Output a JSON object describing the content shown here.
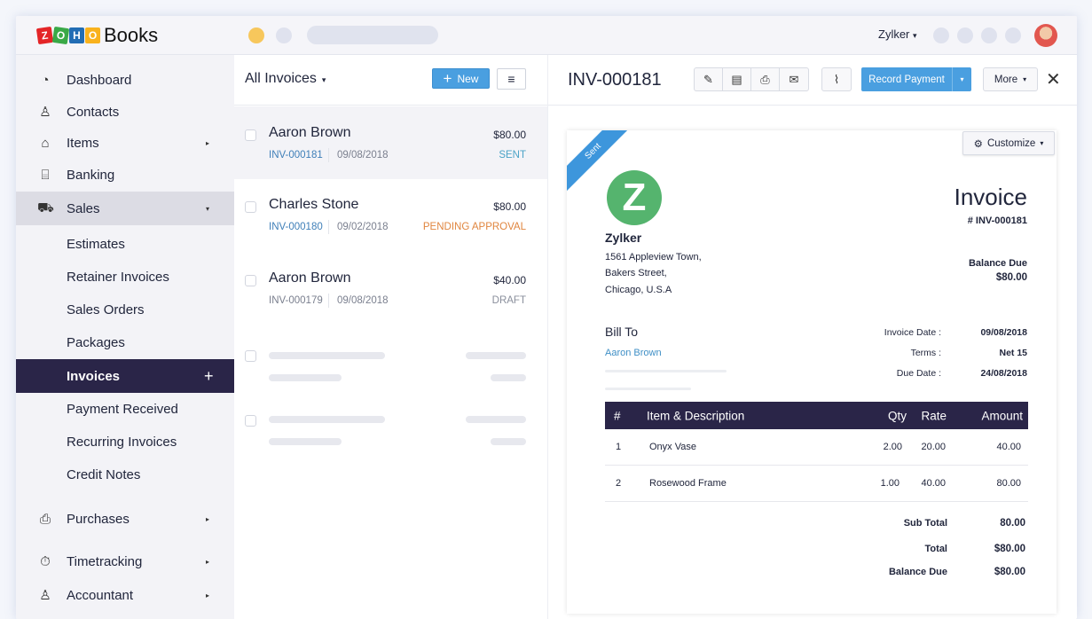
{
  "topbar": {
    "brand_letters": [
      "Z",
      "O",
      "H",
      "O"
    ],
    "brand_name": "Books",
    "org_name": "Zylker",
    "org_caret": "▾"
  },
  "sidebar": {
    "items": [
      {
        "label": "Dashboard",
        "icon": "dashboard-icon",
        "glyph": "◔"
      },
      {
        "label": "Contacts",
        "icon": "contacts-icon",
        "glyph": "♙"
      },
      {
        "label": "Items",
        "icon": "basket-icon",
        "glyph": "⌂",
        "arrow": "▸"
      },
      {
        "label": "Banking",
        "icon": "bank-icon",
        "glyph": "⌸"
      },
      {
        "label": "Sales",
        "icon": "cart-icon",
        "glyph": "⛟",
        "arrow": "▾"
      },
      {
        "label": "Purchases",
        "icon": "shopping-bag-icon",
        "glyph": "⎙",
        "arrow": "▸"
      },
      {
        "label": "Timetracking",
        "icon": "stopwatch-icon",
        "glyph": "⏱",
        "arrow": "▸"
      },
      {
        "label": "Accountant",
        "icon": "accountant-icon",
        "glyph": "♙",
        "arrow": "▸"
      }
    ],
    "sales_sub": [
      {
        "label": "Estimates"
      },
      {
        "label": "Retainer Invoices"
      },
      {
        "label": "Sales Orders"
      },
      {
        "label": "Packages"
      },
      {
        "label": "Invoices",
        "action": "+"
      },
      {
        "label": "Payment Received"
      },
      {
        "label": "Recurring Invoices"
      },
      {
        "label": "Credit Notes"
      }
    ]
  },
  "list": {
    "title": "All Invoices",
    "caret": "▾",
    "new_label": "New",
    "new_icon": "+",
    "menu_icon": "≡",
    "rows": [
      {
        "name": "Aaron Brown",
        "amount": "$80.00",
        "number": "INV-000181",
        "date": "09/08/2018",
        "status": "SENT",
        "status_color": "#4ba3c7"
      },
      {
        "name": "Charles Stone",
        "amount": "$80.00",
        "number": "INV-000180",
        "date": "09/02/2018",
        "status": "PENDING APPROVAL",
        "status_color": "#e0853e"
      },
      {
        "name": "Aaron Brown",
        "amount": "$40.00",
        "number": "INV-000179",
        "date": "09/08/2018",
        "status": "DRAFT",
        "status_color": "#8a8f9c"
      }
    ]
  },
  "detail": {
    "title": "INV-000181",
    "tools": [
      {
        "name": "edit-icon",
        "glyph": "✎"
      },
      {
        "name": "pdf-icon",
        "glyph": "▤"
      },
      {
        "name": "print-icon",
        "glyph": "⎙"
      },
      {
        "name": "email-icon",
        "glyph": "✉"
      }
    ],
    "attach_glyph": "⌇",
    "record_payment_label": "Record Payment",
    "dropdown_caret": "▾",
    "more_label": "More",
    "close_glyph": "✕"
  },
  "invoice": {
    "ribbon": "Sent",
    "customize_label": "Customize",
    "customize_icon": "⚙",
    "logo_letter": "Z",
    "org_name": "Zylker",
    "address": [
      "1561 Appleview Town,",
      "Bakers Street,",
      "Chicago, U.S.A"
    ],
    "doc_title": "Invoice",
    "doc_number": "# INV-000181",
    "balance_due_label": "Balance Due",
    "balance_due_value": "$80.00",
    "bill_to_label": "Bill To",
    "bill_to_name": "Aaron Brown",
    "meta": [
      {
        "label": "Invoice Date :",
        "value": "09/08/2018"
      },
      {
        "label": "Terms :",
        "value": "Net 15"
      },
      {
        "label": "Due Date :",
        "value": "24/08/2018"
      }
    ],
    "columns": [
      "#",
      "Item & Description",
      "Qty",
      "Rate",
      "Amount"
    ],
    "items": [
      {
        "n": "1",
        "desc": "Onyx Vase",
        "qty": "2.00",
        "rate": "20.00",
        "amount": "40.00"
      },
      {
        "n": "2",
        "desc": "Rosewood Frame",
        "qty": "1.00",
        "rate": "40.00",
        "amount": "80.00"
      }
    ],
    "totals": [
      {
        "label": "Sub Total",
        "value": "80.00"
      },
      {
        "label": "Total",
        "value": "$80.00"
      },
      {
        "label": "Balance Due",
        "value": "$80.00"
      }
    ]
  }
}
